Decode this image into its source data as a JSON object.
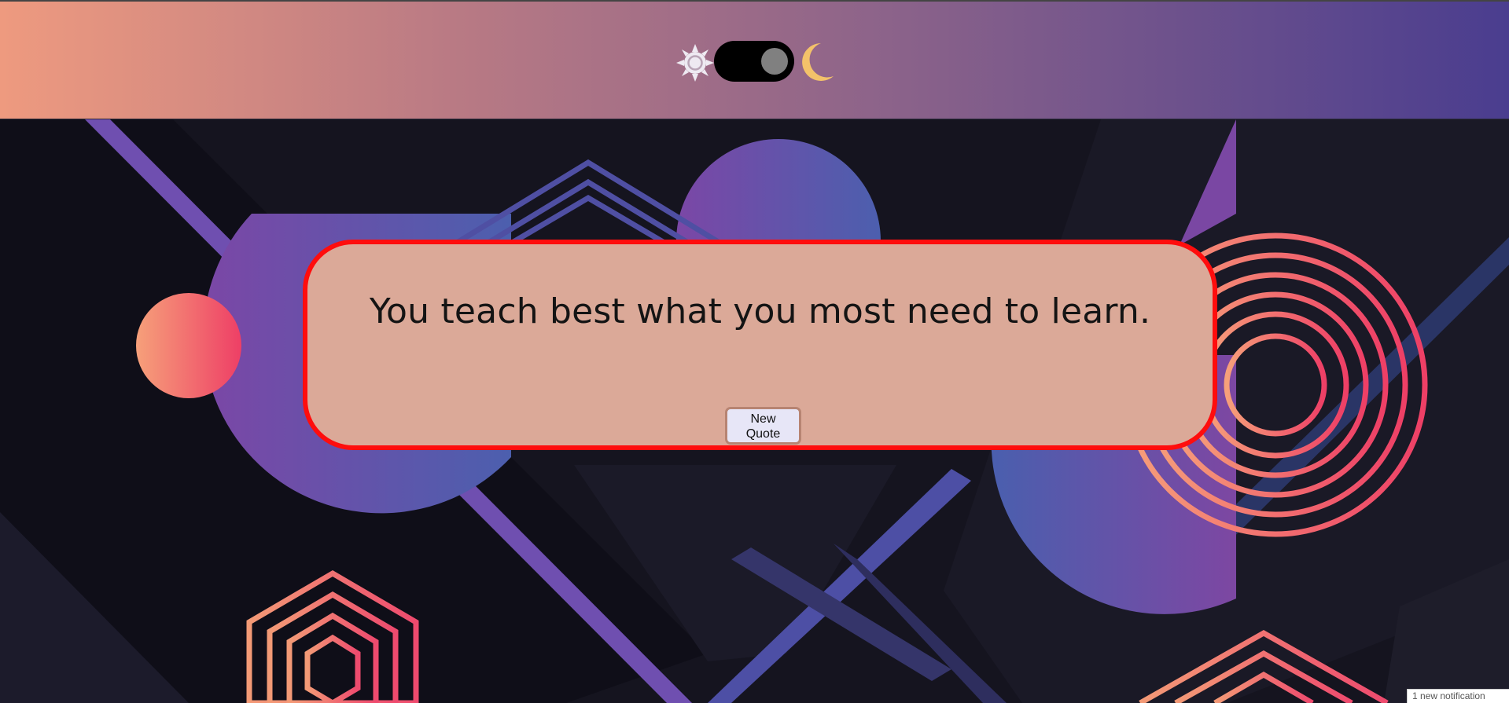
{
  "header": {
    "theme_toggle": {
      "left_icon": "sun-icon",
      "right_icon": "moon-icon",
      "state": "dark",
      "track_color": "#000000",
      "knob_color": "#808080",
      "moon_color": "#f3c26a"
    }
  },
  "quote": {
    "text": "You teach best what you most need to learn.",
    "button_label": "New Quote",
    "card_color": "#dba998",
    "border_color": "#ff0d0d"
  },
  "notification": {
    "text": "1 new notification"
  },
  "colors": {
    "header_gradient_start": "#ee9a7f",
    "header_gradient_end": "#4a3d8f",
    "background": "#15141f",
    "accent_purple": "#7b4aa8",
    "accent_pink": "#f0486c",
    "accent_peach": "#f6a07a"
  }
}
